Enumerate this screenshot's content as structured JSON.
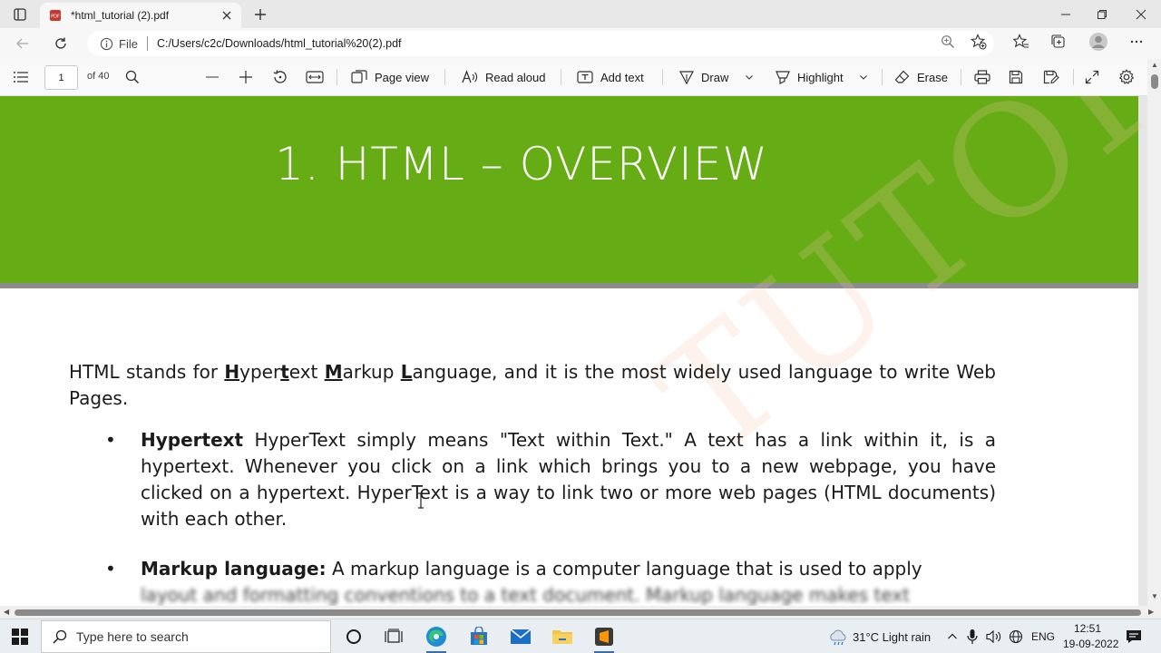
{
  "browser": {
    "tab_title": "*html_tutorial (2).pdf",
    "address": {
      "file_label": "File",
      "url": "C:/Users/c2c/Downloads/html_tutorial%20(2).pdf"
    }
  },
  "pdf_toolbar": {
    "page_number": "1",
    "page_count": "of 40",
    "page_view": "Page view",
    "read_aloud": "Read aloud",
    "add_text": "Add text",
    "draw": "Draw",
    "highlight": "Highlight",
    "erase": "Erase"
  },
  "document": {
    "banner_title": "1. HTML – OVERVIEW",
    "intro": {
      "p1": "HTML stands for ",
      "H": "H",
      "yper": "yper",
      "t": "t",
      "ext": "ext ",
      "M": "M",
      "arkup": "arkup ",
      "L": "L",
      "rest": "anguage, and it is the most widely used language to write Web Pages."
    },
    "bullets": [
      {
        "term": "Hypertext",
        "text": " HyperText simply means \"Text within Text.\" A text has a link within it, is a hypertext. Whenever you click on a link which brings you to a new webpage, you have clicked on a hypertext. HyperText is a way to link two or more web pages (HTML documents) with each other."
      },
      {
        "term": "Markup language:",
        "text": " A markup language is a computer language that is used to apply",
        "cut_off_line": "layout and formatting conventions to a text document. Markup language makes text"
      }
    ],
    "bullet_glyph": "•"
  },
  "taskbar": {
    "search_placeholder": "Type here to search",
    "weather": "31°C  Light rain",
    "language": "ENG",
    "time": "12:51",
    "date": "19-09-2022"
  },
  "colors": {
    "banner_green": "#66ac15",
    "banner_rule": "#8c8c8c"
  }
}
